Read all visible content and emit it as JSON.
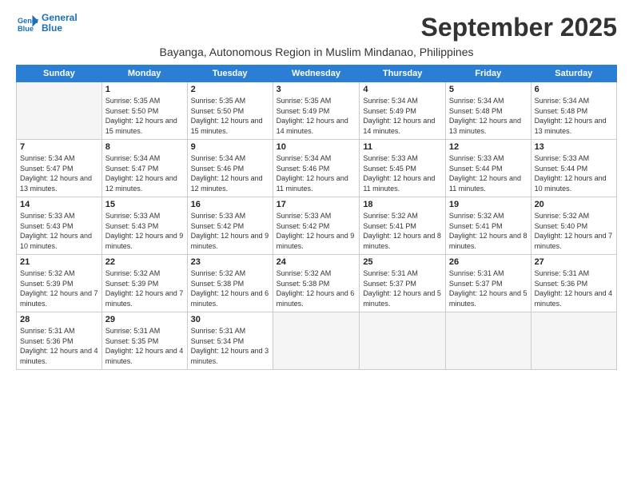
{
  "logo": {
    "line1": "General",
    "line2": "Blue"
  },
  "title": "September 2025",
  "subtitle": "Bayanga, Autonomous Region in Muslim Mindanao, Philippines",
  "days_header": [
    "Sunday",
    "Monday",
    "Tuesday",
    "Wednesday",
    "Thursday",
    "Friday",
    "Saturday"
  ],
  "weeks": [
    [
      {
        "num": "",
        "empty": true
      },
      {
        "num": "1",
        "sunrise": "5:35 AM",
        "sunset": "5:50 PM",
        "daylight": "12 hours and 15 minutes."
      },
      {
        "num": "2",
        "sunrise": "5:35 AM",
        "sunset": "5:50 PM",
        "daylight": "12 hours and 15 minutes."
      },
      {
        "num": "3",
        "sunrise": "5:35 AM",
        "sunset": "5:49 PM",
        "daylight": "12 hours and 14 minutes."
      },
      {
        "num": "4",
        "sunrise": "5:34 AM",
        "sunset": "5:49 PM",
        "daylight": "12 hours and 14 minutes."
      },
      {
        "num": "5",
        "sunrise": "5:34 AM",
        "sunset": "5:48 PM",
        "daylight": "12 hours and 13 minutes."
      },
      {
        "num": "6",
        "sunrise": "5:34 AM",
        "sunset": "5:48 PM",
        "daylight": "12 hours and 13 minutes."
      }
    ],
    [
      {
        "num": "7",
        "sunrise": "5:34 AM",
        "sunset": "5:47 PM",
        "daylight": "12 hours and 13 minutes."
      },
      {
        "num": "8",
        "sunrise": "5:34 AM",
        "sunset": "5:47 PM",
        "daylight": "12 hours and 12 minutes."
      },
      {
        "num": "9",
        "sunrise": "5:34 AM",
        "sunset": "5:46 PM",
        "daylight": "12 hours and 12 minutes."
      },
      {
        "num": "10",
        "sunrise": "5:34 AM",
        "sunset": "5:46 PM",
        "daylight": "12 hours and 11 minutes."
      },
      {
        "num": "11",
        "sunrise": "5:33 AM",
        "sunset": "5:45 PM",
        "daylight": "12 hours and 11 minutes."
      },
      {
        "num": "12",
        "sunrise": "5:33 AM",
        "sunset": "5:44 PM",
        "daylight": "12 hours and 11 minutes."
      },
      {
        "num": "13",
        "sunrise": "5:33 AM",
        "sunset": "5:44 PM",
        "daylight": "12 hours and 10 minutes."
      }
    ],
    [
      {
        "num": "14",
        "sunrise": "5:33 AM",
        "sunset": "5:43 PM",
        "daylight": "12 hours and 10 minutes."
      },
      {
        "num": "15",
        "sunrise": "5:33 AM",
        "sunset": "5:43 PM",
        "daylight": "12 hours and 9 minutes."
      },
      {
        "num": "16",
        "sunrise": "5:33 AM",
        "sunset": "5:42 PM",
        "daylight": "12 hours and 9 minutes."
      },
      {
        "num": "17",
        "sunrise": "5:33 AM",
        "sunset": "5:42 PM",
        "daylight": "12 hours and 9 minutes."
      },
      {
        "num": "18",
        "sunrise": "5:32 AM",
        "sunset": "5:41 PM",
        "daylight": "12 hours and 8 minutes."
      },
      {
        "num": "19",
        "sunrise": "5:32 AM",
        "sunset": "5:41 PM",
        "daylight": "12 hours and 8 minutes."
      },
      {
        "num": "20",
        "sunrise": "5:32 AM",
        "sunset": "5:40 PM",
        "daylight": "12 hours and 7 minutes."
      }
    ],
    [
      {
        "num": "21",
        "sunrise": "5:32 AM",
        "sunset": "5:39 PM",
        "daylight": "12 hours and 7 minutes."
      },
      {
        "num": "22",
        "sunrise": "5:32 AM",
        "sunset": "5:39 PM",
        "daylight": "12 hours and 7 minutes."
      },
      {
        "num": "23",
        "sunrise": "5:32 AM",
        "sunset": "5:38 PM",
        "daylight": "12 hours and 6 minutes."
      },
      {
        "num": "24",
        "sunrise": "5:32 AM",
        "sunset": "5:38 PM",
        "daylight": "12 hours and 6 minutes."
      },
      {
        "num": "25",
        "sunrise": "5:31 AM",
        "sunset": "5:37 PM",
        "daylight": "12 hours and 5 minutes."
      },
      {
        "num": "26",
        "sunrise": "5:31 AM",
        "sunset": "5:37 PM",
        "daylight": "12 hours and 5 minutes."
      },
      {
        "num": "27",
        "sunrise": "5:31 AM",
        "sunset": "5:36 PM",
        "daylight": "12 hours and 4 minutes."
      }
    ],
    [
      {
        "num": "28",
        "sunrise": "5:31 AM",
        "sunset": "5:36 PM",
        "daylight": "12 hours and 4 minutes."
      },
      {
        "num": "29",
        "sunrise": "5:31 AM",
        "sunset": "5:35 PM",
        "daylight": "12 hours and 4 minutes."
      },
      {
        "num": "30",
        "sunrise": "5:31 AM",
        "sunset": "5:34 PM",
        "daylight": "12 hours and 3 minutes."
      },
      {
        "num": "",
        "empty": true
      },
      {
        "num": "",
        "empty": true
      },
      {
        "num": "",
        "empty": true
      },
      {
        "num": "",
        "empty": true
      }
    ]
  ]
}
